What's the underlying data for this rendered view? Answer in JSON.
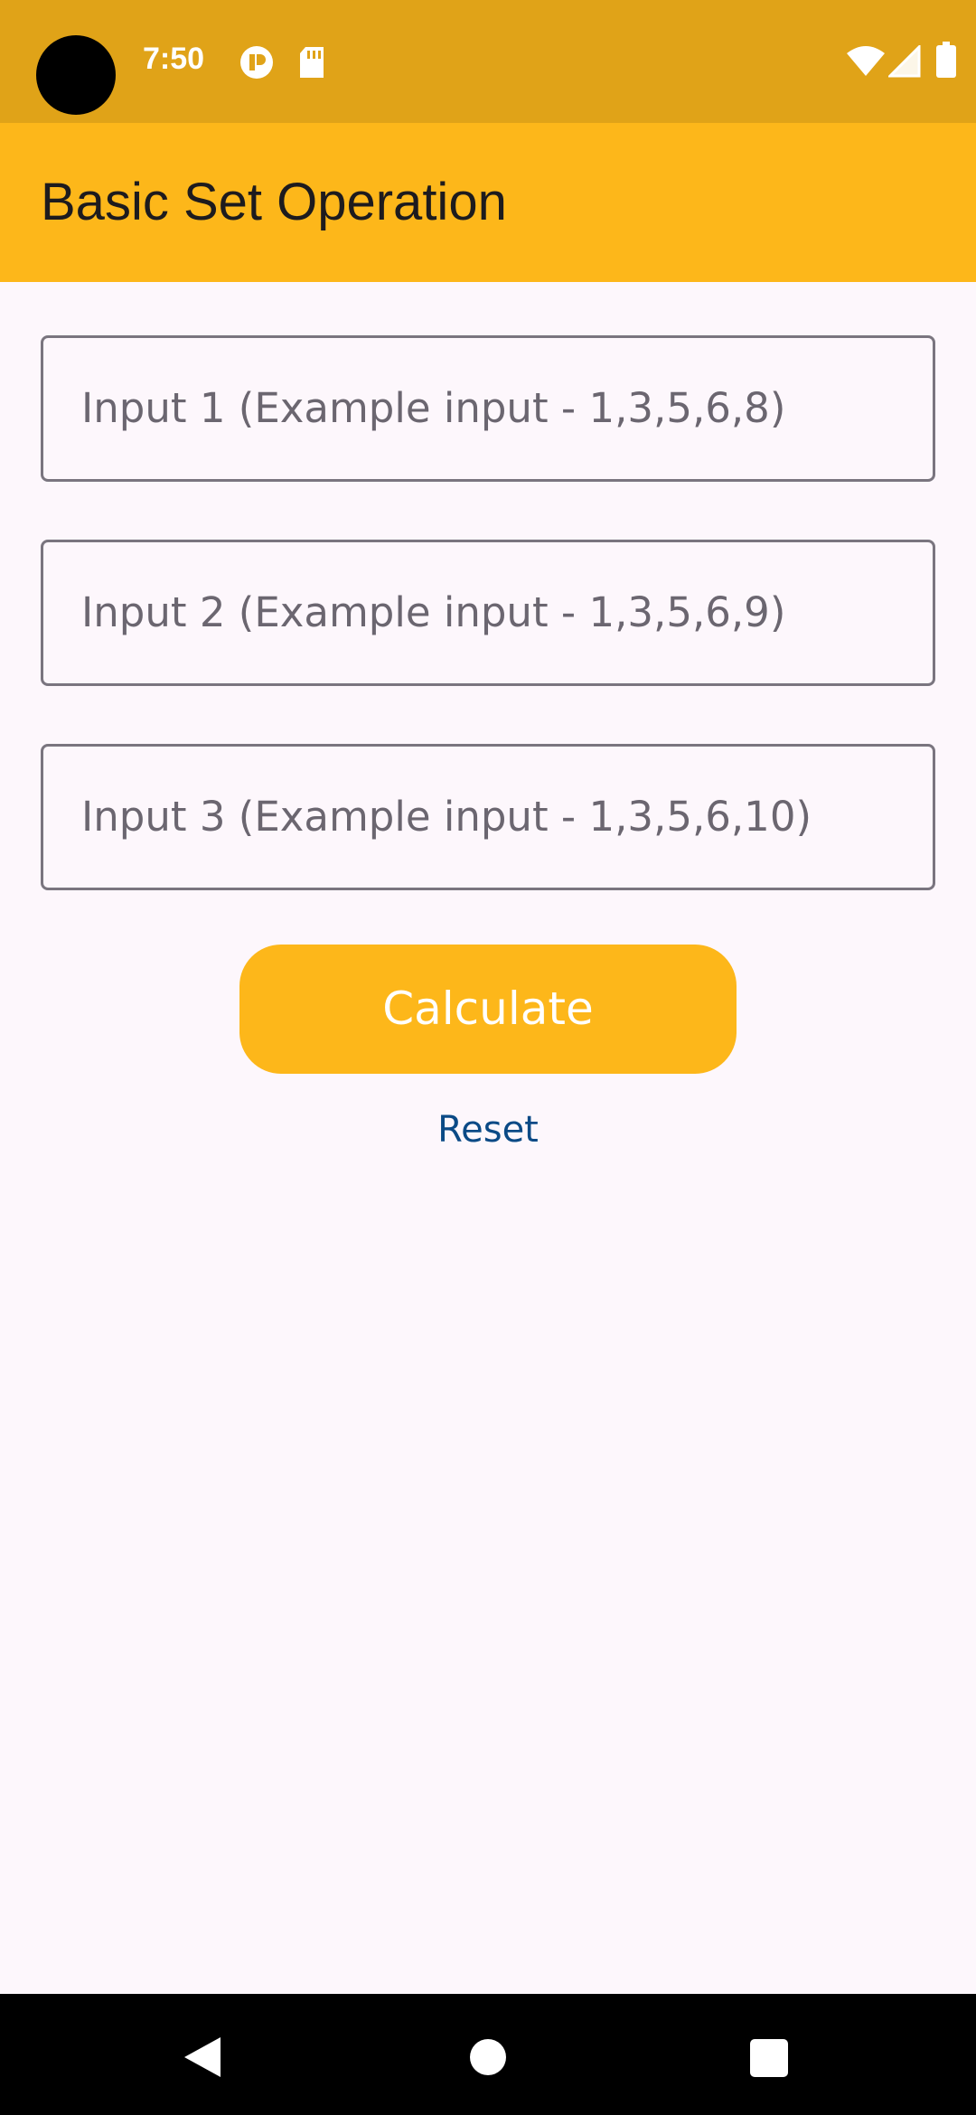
{
  "status_bar": {
    "time": "7:50",
    "icons": [
      "notification-icon",
      "sd-card-icon",
      "wifi-icon",
      "signal-icon",
      "battery-icon"
    ]
  },
  "app_bar": {
    "title": "Basic Set Operation"
  },
  "inputs": [
    {
      "placeholder": "Input 1 (Example input - 1,3,5,6,8)",
      "value": ""
    },
    {
      "placeholder": "Input 2 (Example input - 1,3,5,6,9)",
      "value": ""
    },
    {
      "placeholder": "Input 3 (Example input - 1,3,5,6,10)",
      "value": ""
    }
  ],
  "actions": {
    "calculate_label": "Calculate",
    "reset_label": "Reset"
  },
  "colors": {
    "status_bar": "#E0A318",
    "primary": "#FDB71A",
    "link": "#0B4A86",
    "background": "#FDF7FC"
  },
  "nav_bar": {
    "icons": [
      "back-icon",
      "home-icon",
      "recents-icon"
    ]
  }
}
